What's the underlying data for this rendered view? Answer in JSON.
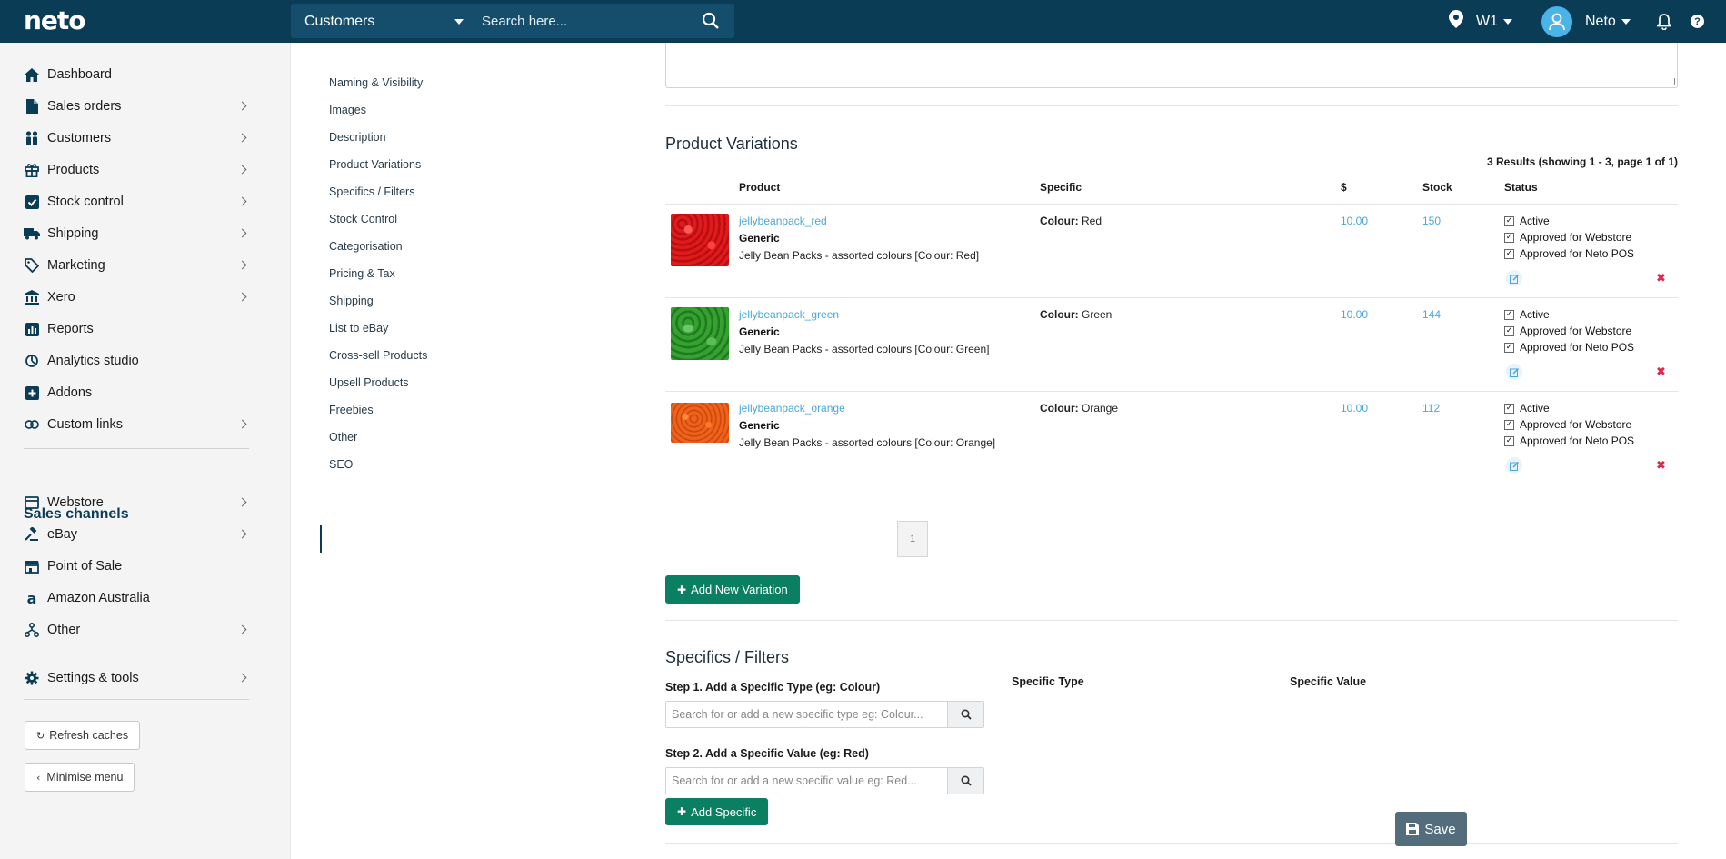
{
  "header": {
    "logo": "neto",
    "search_scope": "Customers",
    "search_placeholder": "Search here...",
    "location": "W1",
    "user": "Neto",
    "help": "?"
  },
  "sidebar": {
    "items": [
      {
        "label": "Dashboard",
        "icon": "home-icon"
      },
      {
        "label": "Sales orders",
        "icon": "document-icon"
      },
      {
        "label": "Customers",
        "icon": "users-icon"
      },
      {
        "label": "Products",
        "icon": "gift-icon"
      },
      {
        "label": "Stock control",
        "icon": "checkbox-icon"
      },
      {
        "label": "Shipping",
        "icon": "truck-icon"
      },
      {
        "label": "Marketing",
        "icon": "tag-icon"
      },
      {
        "label": "Xero",
        "icon": "bank-icon"
      },
      {
        "label": "Reports",
        "icon": "bar-chart-icon"
      },
      {
        "label": "Analytics studio",
        "icon": "analytics-icon"
      },
      {
        "label": "Addons",
        "icon": "plus-square-icon"
      },
      {
        "label": "Custom links",
        "icon": "link-icon"
      }
    ],
    "channels_heading": "Sales channels",
    "channels": [
      {
        "label": "Webstore",
        "icon": "webstore-icon"
      },
      {
        "label": "eBay",
        "icon": "gavel-icon"
      },
      {
        "label": "Point of Sale",
        "icon": "store-icon"
      },
      {
        "label": "Amazon Australia",
        "icon": "amazon-icon"
      },
      {
        "label": "Other",
        "icon": "sitemap-icon"
      }
    ],
    "settings": "Settings & tools",
    "refresh": "Refresh caches",
    "minimise": "Minimise menu"
  },
  "section_nav": [
    "Naming & Visibility",
    "Images",
    "Description",
    "Product Variations",
    "Specifics / Filters",
    "Stock Control",
    "Categorisation",
    "Pricing & Tax",
    "Shipping",
    "List to eBay",
    "Cross-sell Products",
    "Upsell Products",
    "Freebies",
    "Other",
    "SEO"
  ],
  "variations": {
    "title": "Product Variations",
    "results": "3 Results (showing 1 - 3, page 1 of 1)",
    "columns": [
      "Product",
      "Specific",
      "$",
      "Stock",
      "Status"
    ],
    "rows": [
      {
        "sku": "jellybeanpack_red",
        "type": "Generic",
        "name": "Jelly Bean Packs - assorted colours [Colour: Red]",
        "spec_key": "Colour:",
        "spec_val": "Red",
        "price": "10.00",
        "stock": "150",
        "color": "#d8121c"
      },
      {
        "sku": "jellybeanpack_green",
        "type": "Generic",
        "name": "Jelly Bean Packs - assorted colours [Colour: Green]",
        "spec_key": "Colour:",
        "spec_val": "Green",
        "price": "10.00",
        "stock": "144",
        "color": "#2e9a2a"
      },
      {
        "sku": "jellybeanpack_orange",
        "type": "Generic",
        "name": "Jelly Bean Packs - assorted colours [Colour: Orange]",
        "spec_key": "Colour:",
        "spec_val": "Orange",
        "price": "10.00",
        "stock": "112",
        "color": "#f0611a"
      }
    ],
    "status_labels": [
      "Active",
      "Approved for Webstore",
      "Approved for Neto POS"
    ],
    "page": "1",
    "add_button": "Add New Variation"
  },
  "specifics": {
    "title": "Specifics / Filters",
    "step1": "Step 1. Add a Specific Type (eg: Colour)",
    "step1_placeholder": "Search for or add a new specific type eg: Colour...",
    "step2": "Step 2. Add a Specific Value (eg: Red)",
    "step2_placeholder": "Search for or add a new specific value eg: Red...",
    "col_type": "Specific Type",
    "col_value": "Specific Value",
    "add_button": "Add Specific"
  },
  "save": "Save",
  "colors": {
    "topbar": "#0b3c55",
    "accent_green": "#0a7f61",
    "link_blue": "#4aa7d9",
    "delete_red": "#e0274d"
  }
}
